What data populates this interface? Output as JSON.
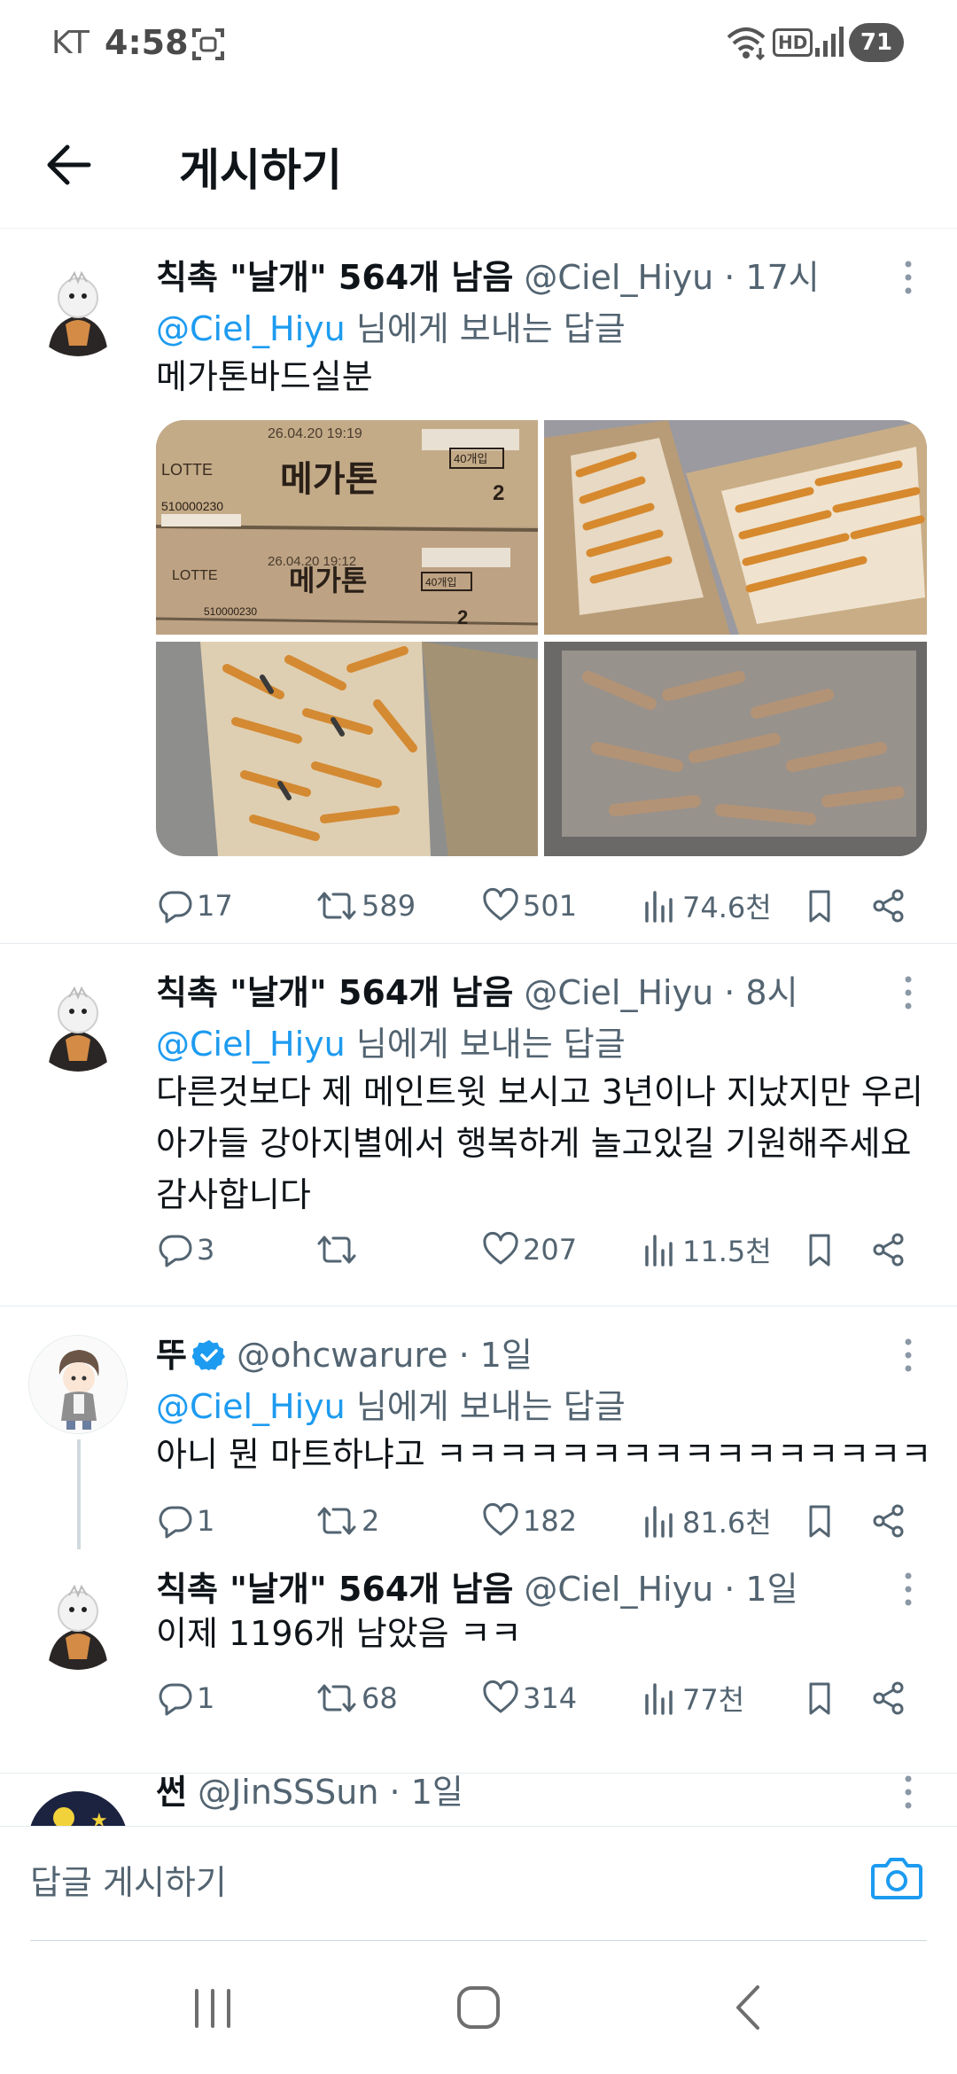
{
  "status_bar": {
    "carrier": "KT",
    "time": "4:58",
    "hd_label": "HD",
    "battery": "71"
  },
  "header": {
    "title": "게시하기"
  },
  "tweets": [
    {
      "name": "칙촉 \"날개\" 564개 남음",
      "handle": "@Ciel_Hiyu",
      "time": "17시",
      "reply_mention": "@Ciel_Hiyu",
      "reply_suffix": " 님에게 보내는 답글",
      "text": "메가톤바드실분",
      "replies": "17",
      "retweets": "589",
      "likes": "501",
      "views": "74.6천"
    },
    {
      "name": "칙촉 \"날개\" 564개 남음",
      "handle": "@Ciel_Hiyu",
      "time": "8시",
      "reply_mention": "@Ciel_Hiyu",
      "reply_suffix": " 님에게 보내는 답글",
      "text": "다른것보다 제 메인트윗 보시고 3년이나 지났지만 우리 아가들 강아지별에서 행복하게 놀고있길 기원해주세요 감사합니다",
      "replies": "3",
      "retweets": "",
      "likes": "207",
      "views": "11.5천"
    },
    {
      "name": "뚜",
      "handle": "@ohcwarure",
      "time": "1일",
      "reply_mention": "@Ciel_Hiyu",
      "reply_suffix": " 님에게 보내는 답글",
      "text": "아니 뭔 마트하냐고 ㅋㅋㅋㅋㅋㅋㅋㅋㅋㅋㅋㅋㅋㅋㅋㅋ",
      "replies": "1",
      "retweets": "2",
      "likes": "182",
      "views": "81.6천"
    },
    {
      "name": "칙촉 \"날개\" 564개 남음",
      "handle": "@Ciel_Hiyu",
      "time": "1일",
      "text": "이제 1196개 남았음 ㅋㅋ",
      "replies": "1",
      "retweets": "68",
      "likes": "314",
      "views": "77천"
    },
    {
      "name": "썬",
      "handle": "@JinSSSun",
      "time": "1일"
    }
  ],
  "media": {
    "box_brand": "LOTTE",
    "box_product": "메가톤",
    "box_count": "40개입",
    "box_date_1": "26.04.20 19:19",
    "box_date_2": "26.04.20 19:12",
    "box_code": "510000230",
    "box_num": "2"
  },
  "dot_separator": " · ",
  "composer": {
    "placeholder": "답글 게시하기"
  },
  "colors": {
    "accent": "#1d9bf0",
    "secondary_text": "#536471",
    "primary_text": "#0f1419"
  }
}
